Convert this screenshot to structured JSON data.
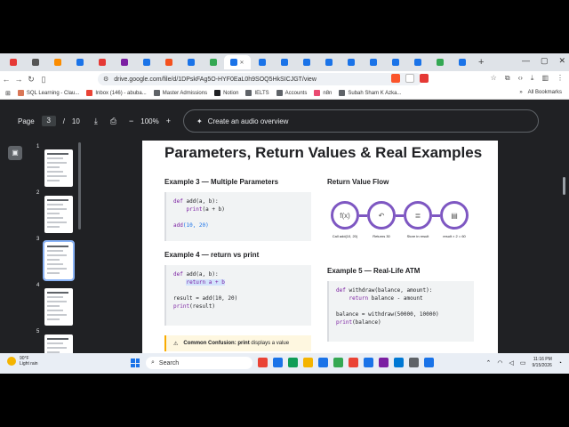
{
  "browser": {
    "url": "drive.google.com/file/d/1DPskFAg5O-HYF0EaL0h9SOQ5HkSICJGT/view",
    "new_tab": "+",
    "tab_colors": [
      "#e53935",
      "#555555",
      "#fb8c00",
      "#1a73e8",
      "#e53935",
      "#7b1fa2",
      "#1a73e8",
      "#f4511e",
      "#1a73e8",
      "#34a853",
      "#1a73e8",
      "#1a73e8",
      "#1a73e8",
      "#1a73e8",
      "#1a73e8",
      "#1a73e8",
      "#1a73e8",
      "#1a73e8",
      "#1a73e8",
      "#34a853",
      "#1a73e8"
    ],
    "bookmarks": [
      {
        "label": "SQL Learning - Clau...",
        "color": "#d97757"
      },
      {
        "label": "Inbox (146) - abuba...",
        "color": "#ea4335"
      },
      {
        "label": "Master Admissions",
        "color": "#5f6368"
      },
      {
        "label": "Notion",
        "color": "#202124"
      },
      {
        "label": "IELTS",
        "color": "#5f6368"
      },
      {
        "label": "Accounts",
        "color": "#5f6368"
      },
      {
        "label": "n8n",
        "color": "#ea4b71"
      },
      {
        "label": "Subah Sham K Azka...",
        "color": "#5f6368"
      }
    ],
    "all_bookmarks": "All Bookmarks"
  },
  "viewer": {
    "page_label": "Page",
    "current_page": "3",
    "page_sep": "/",
    "total_pages": "10",
    "zoom": "100%",
    "zoom_minus": "−",
    "zoom_plus": "+",
    "audio_label": "Create an audio overview",
    "thumbs": [
      {
        "num": "1"
      },
      {
        "num": "2"
      },
      {
        "num": "3"
      },
      {
        "num": "4"
      },
      {
        "num": "5"
      }
    ]
  },
  "document": {
    "title": "Parameters, Return Values & Real Examples",
    "ex3": {
      "heading": "Example 3 — Multiple Parameters",
      "line1_kw": "def",
      "line1_rest": " add(a, b):",
      "line2_kw": "print",
      "line2_rest": "(a + b)",
      "line3_fn": "add",
      "line3_args": "(10, 20)"
    },
    "ex4": {
      "heading": "Example 4 — return vs print",
      "line1_kw": "def",
      "line1_rest": " add(a, b):",
      "line2": "return a + b",
      "line3": "result = add(10, 20)",
      "line4_fn": "print",
      "line4_args": "(result)"
    },
    "flow": {
      "heading": "Return Value Flow",
      "nodes": [
        {
          "icon": "f(x)",
          "caption": "Call add(10, 20)"
        },
        {
          "icon": "↶",
          "caption": "Returns 30"
        },
        {
          "icon": "≣",
          "caption": "Store in result"
        },
        {
          "icon": "▤",
          "caption": "result × 2 = 60"
        }
      ]
    },
    "ex5": {
      "heading": "Example 5 — Real-Life ATM",
      "line1_kw": "def",
      "line1_rest": " withdraw(balance, amount):",
      "line2_kw": "return",
      "line2_rest": " balance - amount",
      "line3": "balance = withdraw(50000, 10000)",
      "line4_fn": "print",
      "line4_args": "(balance)"
    },
    "callout": {
      "icon": "⚠",
      "bold": "Common Confusion:",
      "keyword": "print",
      "rest": " displays a value"
    }
  },
  "taskbar": {
    "temp": "90°F",
    "condition": "Light rain",
    "search_placeholder": "Search",
    "time": "11:16 PM",
    "date": "9/15/2026",
    "app_colors": [
      "#ea4335",
      "#1a73e8",
      "#0f9d58",
      "#f4b400",
      "#1a73e8",
      "#34a853",
      "#ea4335",
      "#1a73e8",
      "#7b1fa2",
      "#0078d4",
      "#5f6368",
      "#1a73e8"
    ]
  }
}
